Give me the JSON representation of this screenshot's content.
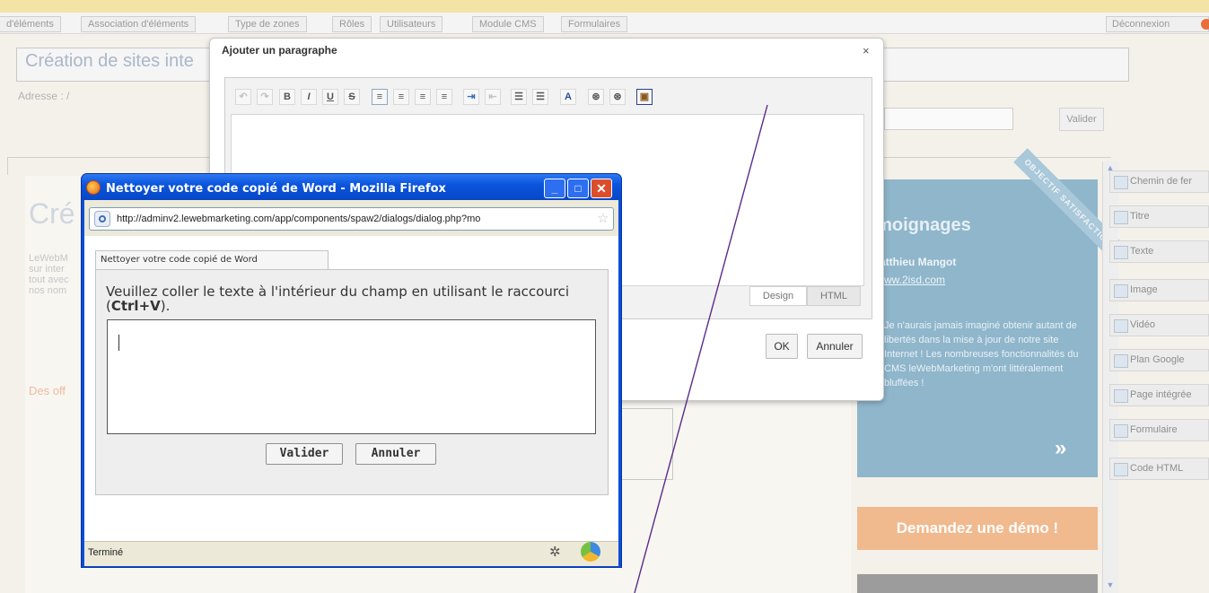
{
  "nav": {
    "tabs": [
      "d'éléments",
      "Association d'éléments",
      "Type de zones",
      "Rôles",
      "Utilisateurs",
      "Module CMS",
      "Formulaires"
    ],
    "logout": "Déconnexion"
  },
  "background": {
    "site_title": "Création de sites inte",
    "adresse_label": "Adresse :",
    "adresse_value": "/",
    "validate": "Valider",
    "page_heading": "Cré",
    "intro_text": "LeWebM sur inter tout avec nos nom",
    "offers_heading": "Des off"
  },
  "testimonials": {
    "title": "émoignages",
    "ribbon": "OBJECTIF SATISFACTION",
    "author": "atthieu Mangot",
    "site": "ww.2isd.com",
    "quote": "Je n'aurais jamais imaginé obtenir autant de libertés dans la mise à jour de notre site Internet ! Les nombreuses fonctionnalités du CMS leWebMarketing m'ont littéralement bluffées !",
    "arrow": "»",
    "demo_button": "Demandez une démo !"
  },
  "sidebar": {
    "items": [
      "Chemin de fer",
      "Titre",
      "Texte",
      "Image",
      "Vidéo",
      "Plan Google",
      "Page intégrée",
      "Formulaire",
      "Code HTML"
    ]
  },
  "paragraph_dialog": {
    "title": "Ajouter un paragraphe",
    "close": "×",
    "toolbar": [
      "undo",
      "redo",
      "B",
      "I",
      "U",
      "S",
      "align-left",
      "align-center",
      "align-right",
      "justify",
      "indent",
      "outdent",
      "ordered-list",
      "bullet-list",
      "text-color",
      "find",
      "replace",
      "paste-from-word"
    ],
    "tab_design": "Design",
    "tab_html": "HTML",
    "ok": "OK",
    "cancel": "Annuler"
  },
  "firefox": {
    "title": "Nettoyer votre code copié de Word - Mozilla Firefox",
    "url": "http://adminv2.lewebmarketing.com/app/components/spaw2/dialogs/dialog.php?mo",
    "tab_label": "Nettoyer votre code copié de Word",
    "instruction_prefix": "Veuillez coller le texte à l'intérieur du champ en utilisant le raccourci (",
    "shortcut": "Ctrl+V",
    "instruction_suffix": ").",
    "validate": "Valider",
    "cancel": "Annuler",
    "status": "Terminé"
  },
  "colors": {
    "xp_blue": "#0a55dd",
    "testimonial_bg": "#8fb6cb",
    "demo_button": "#f0b98e",
    "annotation_line": "#5a2c8a"
  }
}
